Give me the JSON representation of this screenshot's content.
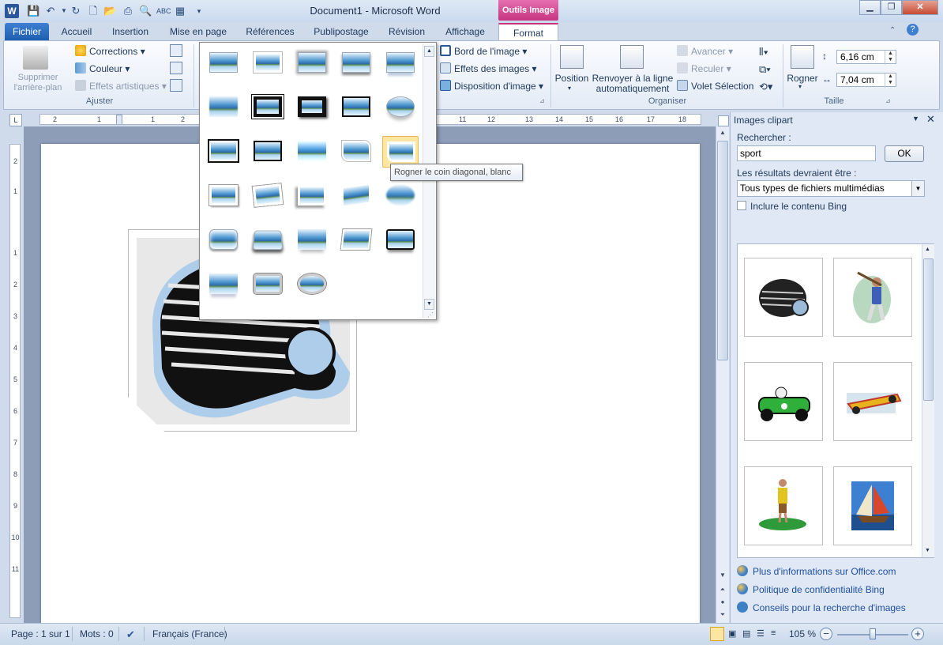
{
  "window": {
    "title": "Document1 - Microsoft Word",
    "app_icon": "W",
    "context_tab_group": "Outils Image"
  },
  "tabs": [
    "Fichier",
    "Accueil",
    "Insertion",
    "Mise en page",
    "Références",
    "Publipostage",
    "Révision",
    "Affichage",
    "Format"
  ],
  "active_tab": "Format",
  "ribbon": {
    "remove_bg": "Supprimer l'arrière-plan",
    "corrections": "Corrections",
    "color": "Couleur",
    "artistic": "Effets artistiques",
    "group_adjust": "Ajuster",
    "picture_border": "Bord de l'image",
    "picture_effects": "Effets des images",
    "picture_layout": "Disposition d'image",
    "position": "Position",
    "wrap_text_1": "Renvoyer à la ligne",
    "wrap_text_2": "automatiquement",
    "bring_forward": "Avancer",
    "send_backward": "Reculer",
    "selection_pane": "Volet Sélection",
    "group_arrange": "Organiser",
    "crop": "Rogner",
    "height": "6,16 cm",
    "width": "7,04 cm",
    "group_size": "Taille"
  },
  "ruler": {
    "h_numbers": [
      "2",
      "1",
      "1",
      "2",
      "11",
      "12",
      "13",
      "14",
      "15",
      "16",
      "17",
      "18"
    ],
    "v_numbers": [
      "2",
      "1",
      "1",
      "2",
      "3",
      "4",
      "5",
      "6",
      "7",
      "8",
      "9",
      "10",
      "11"
    ]
  },
  "gallery": {
    "tooltip": "Rogner le coin diagonal, blanc",
    "styles_count": 28
  },
  "clipart": {
    "title": "Images clipart",
    "search_label": "Rechercher :",
    "search_value": "sport",
    "ok": "OK",
    "results_label": "Les résultats devraient être :",
    "results_value": "Tous types de fichiers multimédias",
    "include_bing": "Inclure le contenu Bing",
    "items": [
      "football-helmet",
      "baseball-player",
      "race-car-green",
      "formula-car",
      "golfer",
      "sailboat"
    ],
    "links": [
      "Plus d'informations sur Office.com",
      "Politique de confidentialité Bing",
      "Conseils pour la recherche d'images"
    ]
  },
  "status": {
    "page": "Page : 1 sur 1",
    "words": "Mots : 0",
    "language": "Français (France)",
    "zoom": "105 %"
  },
  "colors": {
    "accent": "#2b579a",
    "context": "#c7357f",
    "ribbon_bg": "#e3ebf6"
  }
}
